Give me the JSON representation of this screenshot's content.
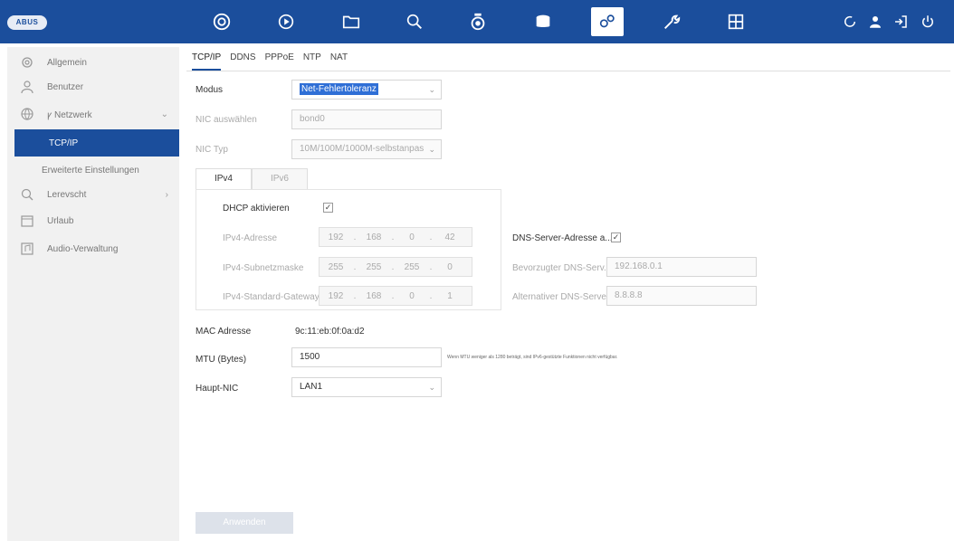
{
  "brand": {
    "logo_text": "ABUS"
  },
  "topnav": {
    "icons": [
      "live-view-icon",
      "playback-icon",
      "folder-icon",
      "search-icon",
      "camera-icon",
      "storage-icon",
      "settings-gears-icon",
      "wrench-icon",
      "grid-icon"
    ],
    "active": "settings-gears-icon",
    "right_icons": [
      "refresh-icon",
      "user-icon",
      "logout-icon",
      "power-icon"
    ]
  },
  "colors": {
    "accent": "#1b4e9c",
    "selection": "#2f6fd6"
  },
  "sidebar": {
    "items": [
      {
        "label": "Allgemein",
        "icon": "gear-icon"
      },
      {
        "label": "Benutzer",
        "icon": "user-icon"
      },
      {
        "label": "ꝩ Netzwerk",
        "icon": "globe-icon",
        "expanded": true
      },
      {
        "label": "TCP/IP",
        "sub": true,
        "selected": true
      },
      {
        "label": "Erweiterte Einstellungen",
        "sub": true
      },
      {
        "label": "Lerevscht",
        "icon": "magnifier-icon"
      },
      {
        "label": "Urlaub",
        "icon": "calendar-icon"
      },
      {
        "label": "Audio-Verwaltung",
        "icon": "audio-icon"
      }
    ]
  },
  "tabs": [
    "TCP/IP",
    "DDNS",
    "PPPoE",
    "NTP",
    "NAT"
  ],
  "form": {
    "modus": {
      "label": "Modus",
      "value": "Net-Fehlertoleranz"
    },
    "nic_auswaehlen": {
      "label": "NIC auswählen",
      "value": "bond0"
    },
    "nic_typ": {
      "label": "NIC Typ",
      "value": "10M/100M/1000M-selbstanpas"
    },
    "subtabs": [
      "IPv4",
      "IPv6"
    ],
    "dhcp": {
      "label": "DHCP aktivieren",
      "checked": true
    },
    "ipv4_adresse": {
      "label": "IPv4-Adresse",
      "octets": [
        "192",
        "168",
        "0",
        "42"
      ]
    },
    "subnetzmaske": {
      "label": "IPv4-Subnetzmaske",
      "octets": [
        "255",
        "255",
        "255",
        "0"
      ]
    },
    "gateway": {
      "label": "IPv4-Standard-Gateway",
      "octets": [
        "192",
        "168",
        "0",
        "1"
      ]
    },
    "dns_auto": {
      "label": "DNS-Server-Adresse a...",
      "checked": true
    },
    "dns_preferred": {
      "label": "Bevorzugter DNS-Serv...",
      "value": "192.168.0.1"
    },
    "dns_alternate": {
      "label": "Alternativer DNS-Server",
      "value": "8.8.8.8"
    },
    "mac": {
      "label": "MAC Adresse",
      "value": "9c:11:eb:0f:0a:d2"
    },
    "mtu": {
      "label": "MTU (Bytes)",
      "value": "1500",
      "hint": "Wenn MTU weniger als 1280 beträgt, sind IPv6-gestützte Funktionen nicht verfügbar."
    },
    "haupt_nic": {
      "label": "Haupt-NIC",
      "value": "LAN1"
    },
    "apply_label": "Anwenden"
  }
}
